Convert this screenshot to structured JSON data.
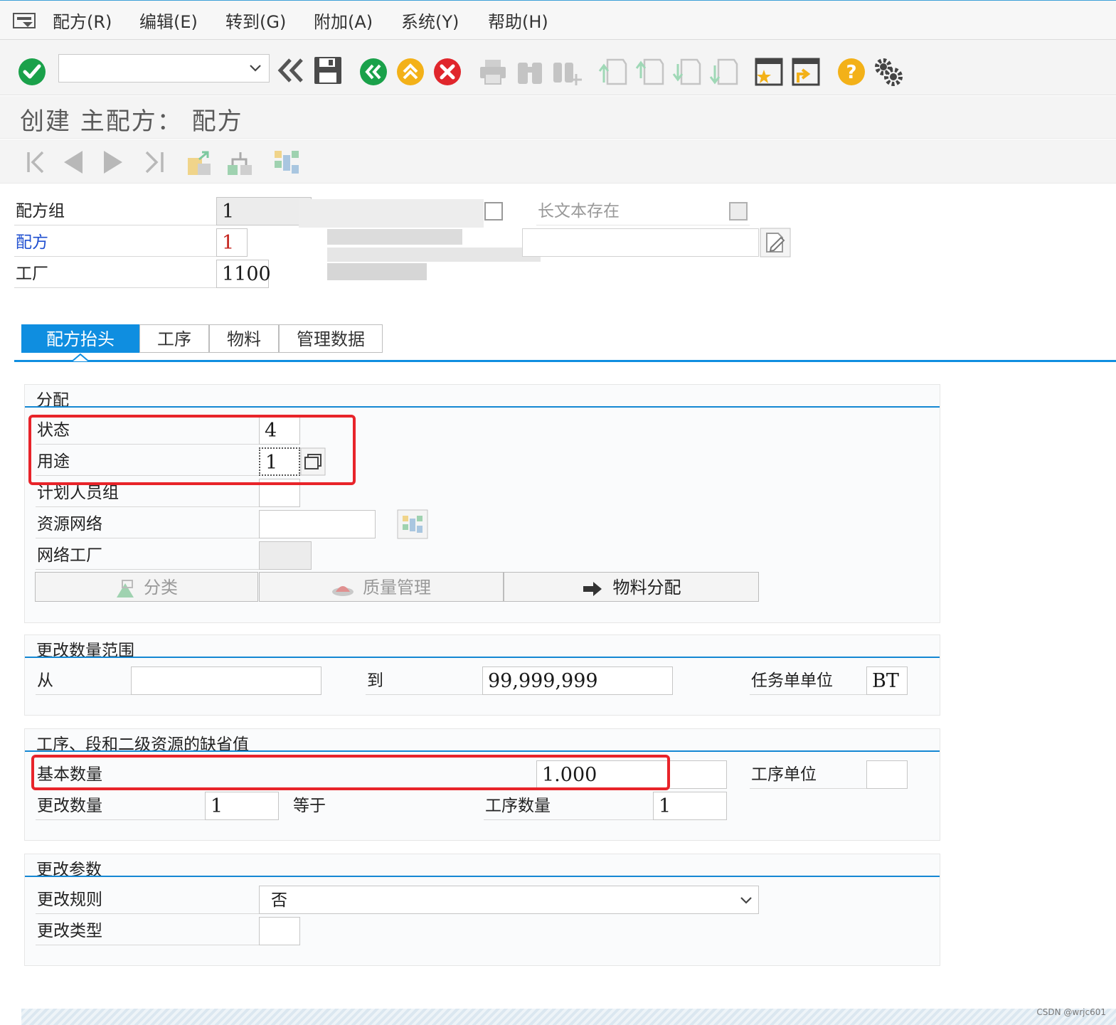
{
  "menu": {
    "items": [
      "配方(R)",
      "编辑(E)",
      "转到(G)",
      "附加(A)",
      "系统(Y)",
      "帮助(H)"
    ]
  },
  "toolbar": {
    "command_value": "",
    "icons": [
      "check-icon",
      "command-dropdown-icon",
      "back-double-icon",
      "save-icon",
      "back-icon",
      "exit-icon",
      "cancel-icon",
      "print-icon",
      "find-icon",
      "find-next-icon",
      "first-page-icon",
      "previous-page-icon",
      "next-page-icon",
      "last-page-icon",
      "new-session-icon",
      "shortcut-icon",
      "help-icon",
      "settings-icon"
    ]
  },
  "title": "创建 主配方： 配方",
  "header": {
    "recipe_group_label": "配方组",
    "recipe_group_value": "1",
    "recipe_label": "配方",
    "recipe_value": "1",
    "plant_label": "工厂",
    "plant_value": "1100",
    "long_text_label": "长文本存在"
  },
  "tabs": [
    "配方抬头",
    "工序",
    "物料",
    "管理数据"
  ],
  "assignment": {
    "title": "分配",
    "status_label": "状态",
    "status_value": "4",
    "usage_label": "用途",
    "usage_value": "1",
    "planner_group_label": "计划人员组",
    "planner_group_value": "",
    "resource_network_label": "资源网络",
    "resource_network_value": "",
    "network_plant_label": "网络工厂",
    "network_plant_value": "",
    "btn_classification": "分类",
    "btn_quality": "质量管理",
    "btn_material_assignment": "物料分配"
  },
  "lot_size": {
    "title": "更改数量范围",
    "from_label": "从",
    "from_value": "",
    "to_label": "到",
    "to_value": "99,999,999",
    "unit_label": "任务单单位",
    "unit_value": "BT"
  },
  "defaults": {
    "title": "工序、段和二级资源的缺省值",
    "base_qty_label": "基本数量",
    "base_qty_value": "1.000",
    "op_unit_label": "工序单位",
    "op_unit_value": "",
    "change_qty_label": "更改数量",
    "change_qty_value": "1",
    "equals_label": "等于",
    "op_qty_label": "工序数量",
    "op_qty_value": "1"
  },
  "change_params": {
    "title": "更改参数",
    "rule_label": "更改规则",
    "rule_value": "否",
    "type_label": "更改类型",
    "type_value": ""
  },
  "watermark": "CSDN @wrjc601",
  "colors": {
    "accent": "#0f8ee0",
    "highlight_box": "#e8242a",
    "ok_green": "#1aa14a",
    "warn_yellow": "#f3b118",
    "cancel_red": "#e0262c"
  }
}
